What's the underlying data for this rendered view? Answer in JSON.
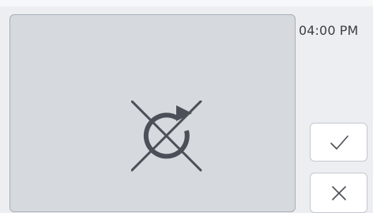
{
  "status": {
    "time": "04:00 PM"
  },
  "preview": {
    "icon": "no-refresh-icon"
  },
  "actions": {
    "confirm_icon": "checkmark-icon",
    "cancel_icon": "close-icon"
  },
  "colors": {
    "panel_background": "#d6dadf",
    "panel_border": "#a9aeb7",
    "icon_color": "#4b4f57",
    "button_background": "#ffffff"
  }
}
